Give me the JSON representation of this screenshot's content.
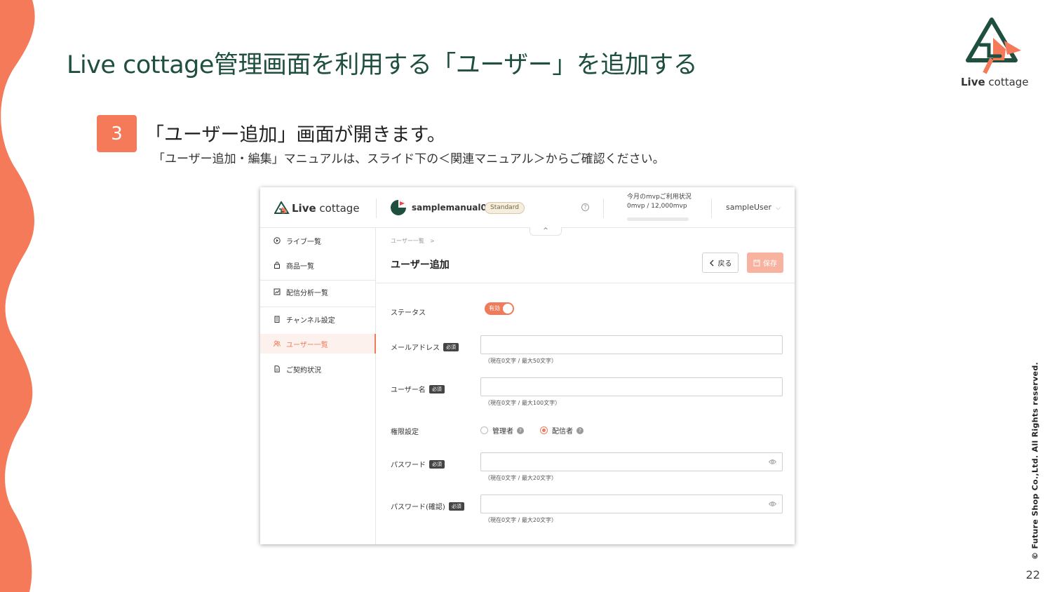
{
  "slide": {
    "title": "Live cottage管理画面を利用する「ユーザー」を追加する",
    "brand_logo_bold": "Live",
    "brand_logo_rest": " cottage",
    "step_number": "3",
    "step_heading": "「ユーザー追加」画面が開きます。",
    "step_note": "「ユーザー追加・編集」マニュアルは、スライド下の＜関連マニュアル＞からご確認ください。",
    "copyright": "© Future Shop Co.,Ltd. All Rights reserved.",
    "page_number": "22",
    "accent_color": "#f47a5a",
    "title_color": "#1e4f3f"
  },
  "app": {
    "logo_bold": "Live",
    "logo_rest": " cottage",
    "tenant_name": "samplemanual01",
    "plan": "Standard",
    "help_icon": "?",
    "mvp_label": "今月のmvpご利用状況",
    "mvp_value": "0mvp / 12,000mvp",
    "mvp_usage": 0,
    "user_name": "sampleUser",
    "collapse_icon": "^",
    "sidebar": [
      {
        "label": "ライブ一覧",
        "icon": "play-circle-icon"
      },
      {
        "label": "商品一覧",
        "icon": "shopping-bag-icon"
      },
      {
        "label": "配信分析一覧",
        "icon": "chart-icon"
      },
      {
        "label": "チャンネル設定",
        "icon": "building-icon"
      },
      {
        "label": "ユーザー一覧",
        "icon": "users-icon",
        "active": true
      },
      {
        "label": "ご契約状況",
        "icon": "document-icon"
      }
    ],
    "breadcrumb": "ユーザー一覧　>",
    "page_title": "ユーザー追加",
    "back_label": "戻る",
    "save_label": "保存",
    "required_label": "必須",
    "form": {
      "status_label": "ステータス",
      "status_value": "有効",
      "email_label": "メールアドレス",
      "email_value": "",
      "email_hint": "（現在0文字 / 最大50文字）",
      "username_label": "ユーザー名",
      "username_value": "",
      "username_hint": "（現在0文字 / 最大100文字）",
      "role_label": "権限設定",
      "role_options": [
        "管理者",
        "配信者"
      ],
      "role_selected": "配信者",
      "password_label": "パスワード",
      "password_hint": "（現在0文字 / 最大20文字）",
      "password_confirm_label": "パスワード(確認)",
      "password_confirm_hint": "（現在0文字 / 最大20文字）"
    }
  }
}
